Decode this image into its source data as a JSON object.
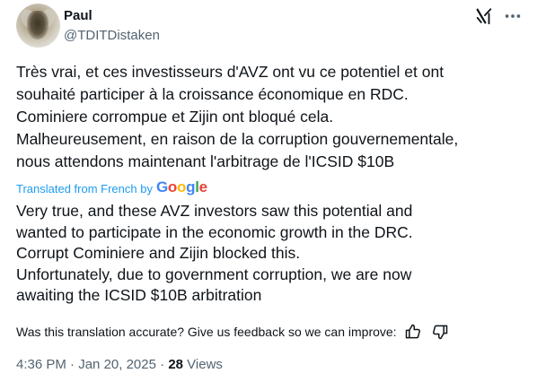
{
  "author": {
    "name": "Paul",
    "handle": "@TDITDistaken"
  },
  "post": {
    "original_text": "Très vrai, et ces investisseurs d'AVZ ont vu ce potentiel et ont\nsouhaité participer à la croissance économique en RDC.\nCominiere corrompue et Zijin ont bloqué cela.\nMalheureusement, en raison de la corruption gouvernementale,\nnous attendons maintenant l'arbitrage de l'ICSID $10B",
    "translated_label": "Translated from French by",
    "translation_provider": "Google",
    "translated_text": "Very true, and these AVZ investors saw this potential and\nwanted to participate in the economic growth in the DRC.\nCorrupt Cominiere and Zijin blocked this.\nUnfortunately, due to government corruption, we are now\nawaiting the ICSID $10B arbitration"
  },
  "feedback": {
    "question": "Was this translation accurate? Give us feedback so we can improve:"
  },
  "meta": {
    "time": "4:36 PM",
    "separator": "·",
    "date": "Jan 20, 2025",
    "views_count": "28",
    "views_label": "Views"
  },
  "icons": {
    "grok": "grok-icon",
    "more": "more-icon",
    "thumbs_up": "thumbs-up-icon",
    "thumbs_down": "thumbs-down-icon"
  },
  "colors": {
    "text": "#0f1419",
    "secondary": "#536471",
    "link": "#1d9bf0"
  }
}
